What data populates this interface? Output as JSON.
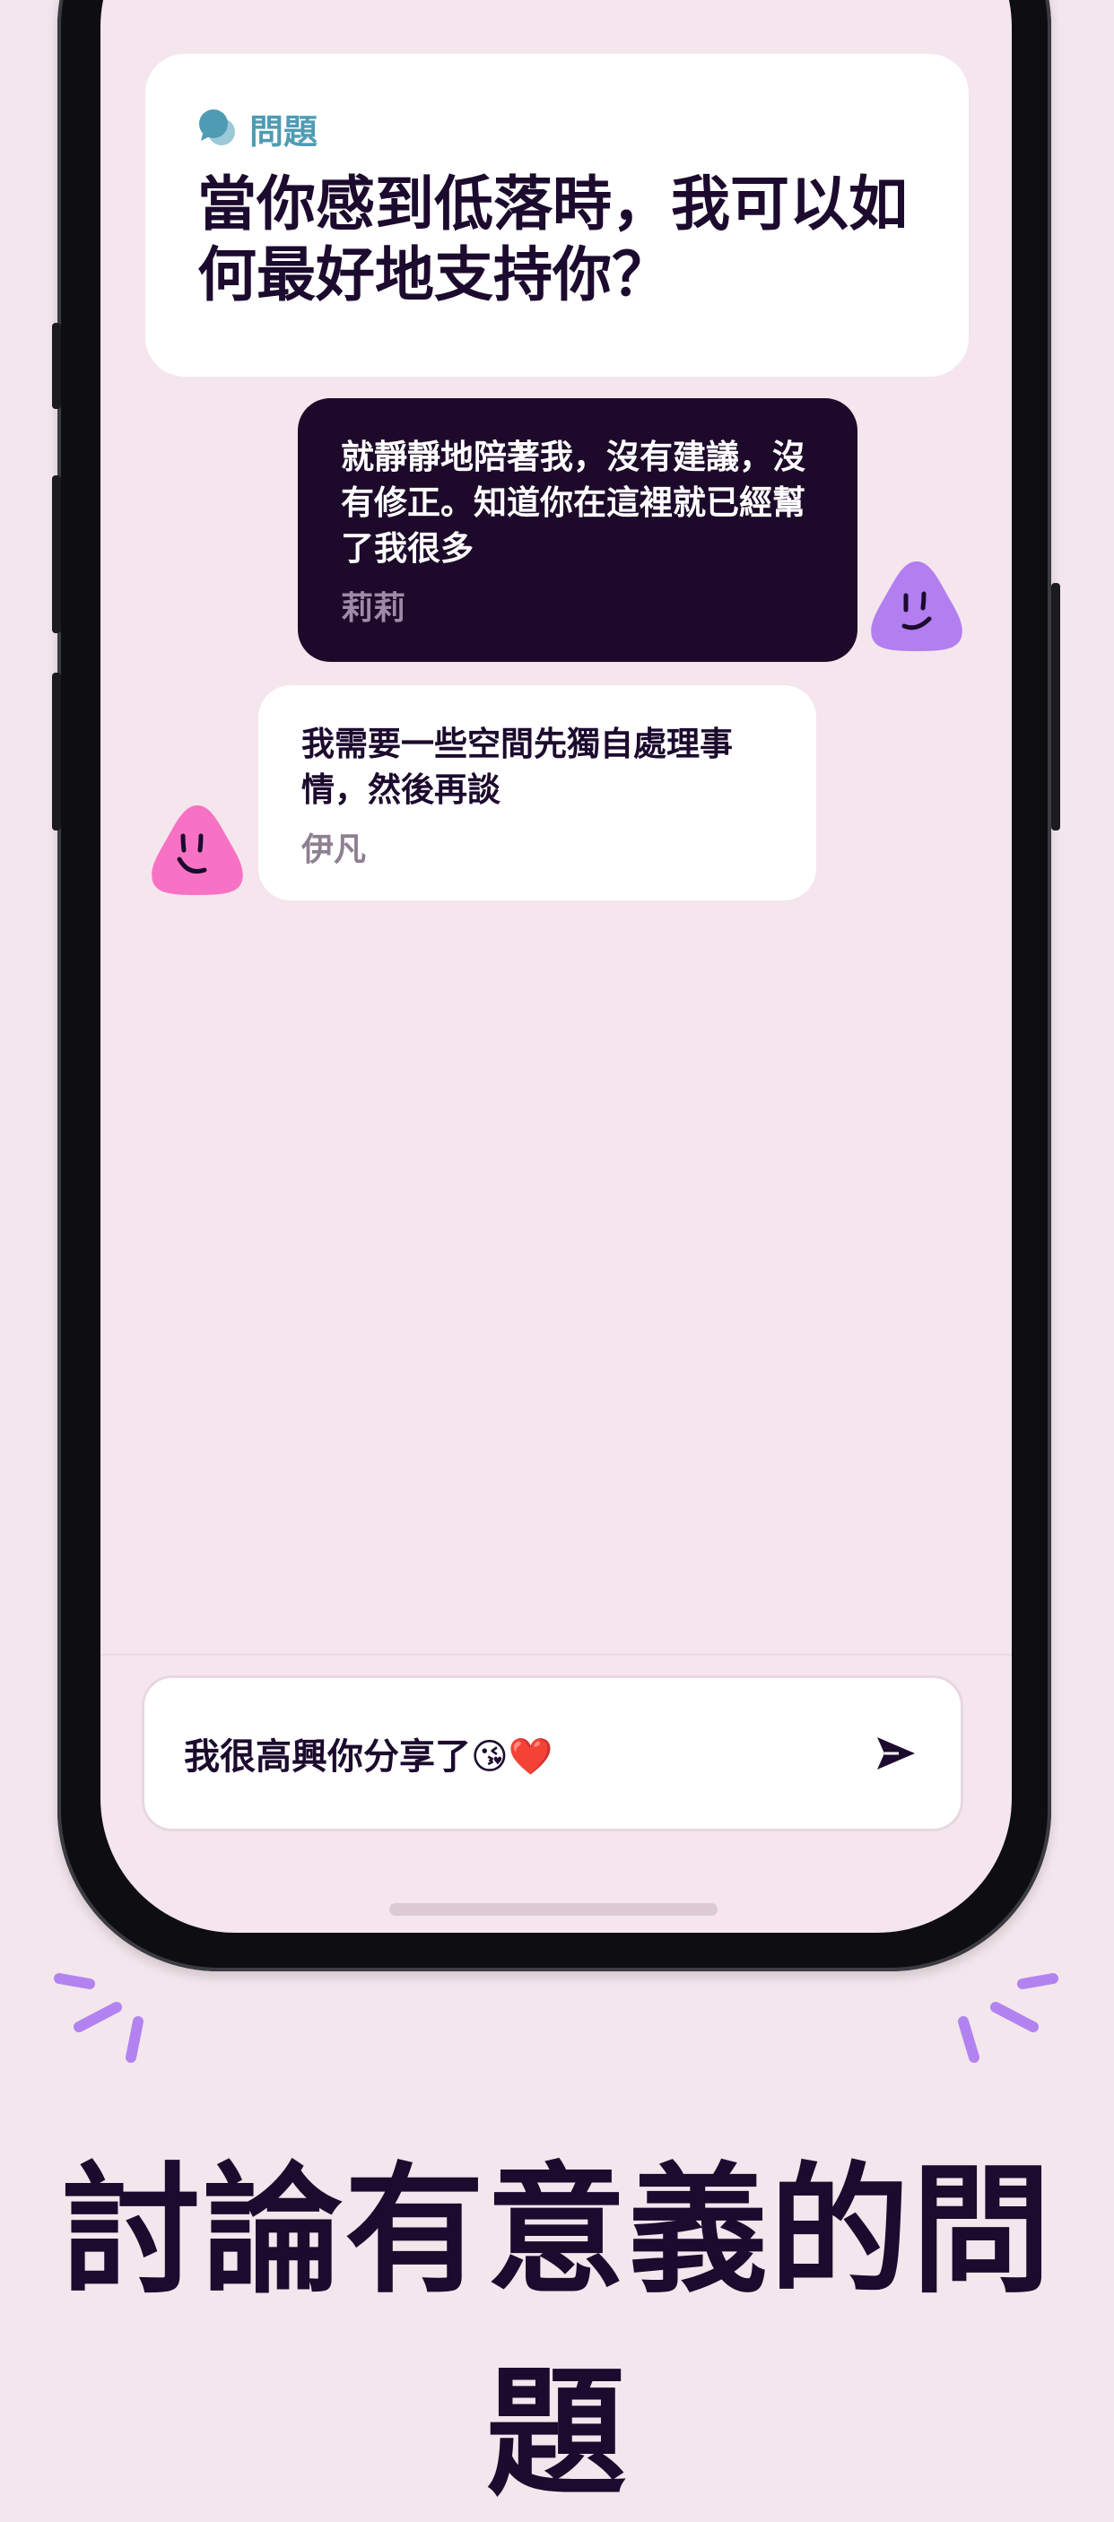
{
  "question_card": {
    "tag_label": "問題",
    "title": "當你感到低落時，我可以如何最好地支持你？"
  },
  "messages": [
    {
      "text": "就靜靜地陪著我，沒有建議，沒有修正。知道你在這裡就已經幫了我很多",
      "author": "莉莉",
      "avatar": "purple-smiley-icon"
    },
    {
      "text": "我需要一些空間先獨自處理事情，然後再談",
      "author": "伊凡",
      "avatar": "pink-smiley-icon"
    }
  ],
  "input": {
    "value": "我很高興你分享了😘❤️",
    "send_icon": "send-icon"
  },
  "headline": "討論有意義的問題",
  "colors": {
    "background": "#f3e6ec",
    "dark_bubble": "#1d0a2a",
    "accent_teal": "#4f9bb3",
    "avatar_purple": "#b27ef0",
    "avatar_pink": "#f772c4",
    "sparkle_purple": "#b283f0"
  }
}
